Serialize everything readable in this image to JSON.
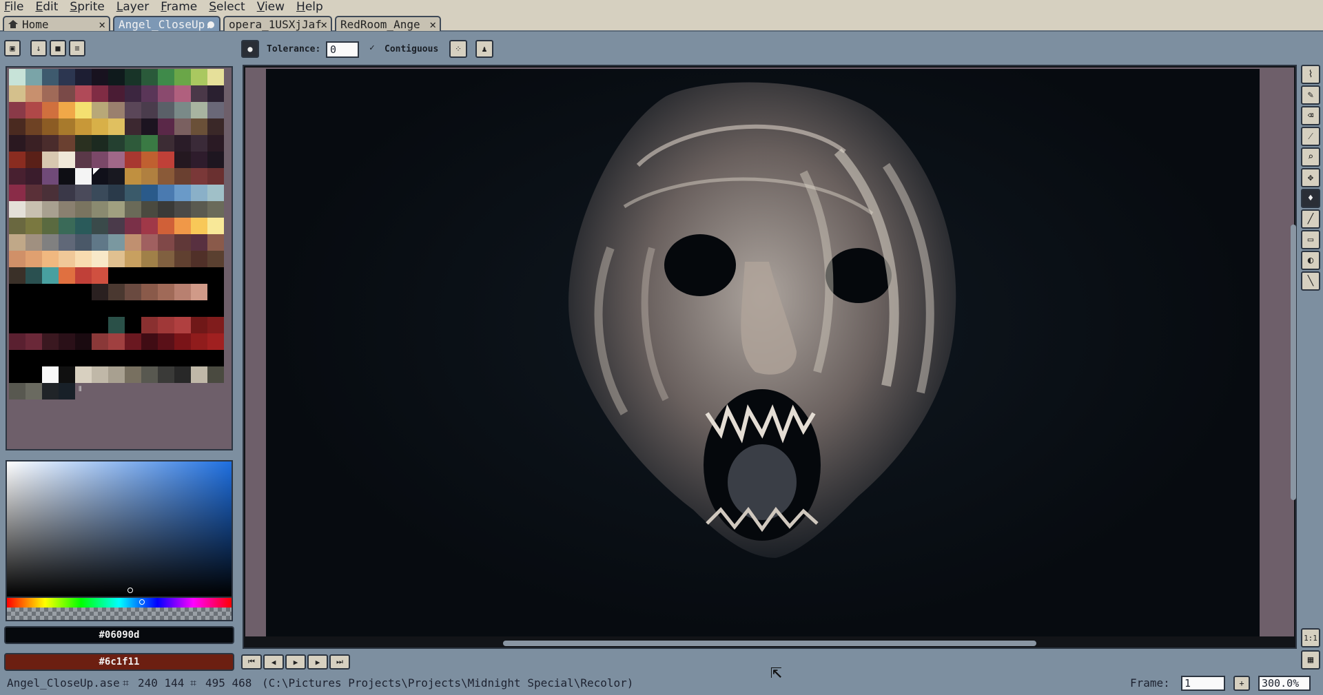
{
  "app": {
    "menu": [
      {
        "label": "File",
        "ul": "F",
        "rest": "ile"
      },
      {
        "label": "Edit",
        "ul": "E",
        "rest": "dit"
      },
      {
        "label": "Sprite",
        "ul": "S",
        "rest": "prite"
      },
      {
        "label": "Layer",
        "ul": "L",
        "rest": "ayer"
      },
      {
        "label": "Frame",
        "ul": "F",
        "rest": "rame"
      },
      {
        "label": "Select",
        "ul": "S",
        "rest": "elect"
      },
      {
        "label": "View",
        "ul": "V",
        "rest": "iew"
      },
      {
        "label": "Help",
        "ul": "H",
        "rest": "elp"
      }
    ]
  },
  "tabs": [
    {
      "label": "Home",
      "state": "normal"
    },
    {
      "label": "Angel_CloseUp.",
      "state": "active-modified"
    },
    {
      "label": "opera_1USXjJaf",
      "state": "normal"
    },
    {
      "label": "RedRoom_Ange",
      "state": "normal"
    }
  ],
  "context_bar": {
    "tolerance_label": "Tolerance:",
    "tolerance_value": "0",
    "contiguous_label": "Contiguous",
    "contiguous_checked": true
  },
  "palette": {
    "colors": [
      "#c7e3d8",
      "#7aa4a8",
      "#3e5a6e",
      "#2c3650",
      "#1d1e33",
      "#18121f",
      "#0f1a1c",
      "#183428",
      "#2a5a3a",
      "#3f8a4a",
      "#6aa648",
      "#aac860",
      "#e6e09a",
      "#d4c08c",
      "#c8906e",
      "#a06a58",
      "#7a4a48",
      "#b04a58",
      "#802c44",
      "#4a1c34",
      "#3c2640",
      "#5a3658",
      "#8a4a6e",
      "#b0607e",
      "#4a3848",
      "#2a2030",
      "#8a3a48",
      "#b04848",
      "#d0703e",
      "#f0a848",
      "#f4e070",
      "#b8a878",
      "#9a806e",
      "#5a4658",
      "#4a3c4c",
      "#5a6068",
      "#7a8a88",
      "#a8b4a0",
      "#6a6878",
      "#4a2a20",
      "#6e4224",
      "#8c5c24",
      "#a87a2c",
      "#c89838",
      "#d8b048",
      "#e0c060",
      "#3c2830",
      "#1c1420",
      "#5a2848",
      "#7a6060",
      "#6a5038",
      "#3a2828",
      "#2a1820",
      "#3a2024",
      "#4a2c2c",
      "#6a4030",
      "#2a3020",
      "#1c2a20",
      "#244030",
      "#2e5a3a",
      "#3a7a44",
      "#3c2c34",
      "#2a1c28",
      "#3a2a38",
      "#2a1a24",
      "#8a2c20",
      "#5a2018",
      "#d8c8b0",
      "#f0e8d8",
      "#5a3848",
      "#7a4868",
      "#a06888",
      "#a83830",
      "#c06030",
      "#c04038",
      "#241820",
      "#2e1c2c",
      "#1e1620",
      "#482030",
      "#3a1c2c",
      "#704a78",
      "#0e0e14",
      "#f4f4f4",
      "#10101a",
      "#181820",
      "#c09040",
      "#b08040",
      "#8a5a38",
      "#6a4030",
      "#7a3838",
      "#6a3030",
      "#8a2c48",
      "#5a3038",
      "#4a3038",
      "#3a3848",
      "#4a4a5a",
      "#3a4a5a",
      "#2a3a4a",
      "#3a5a6a",
      "#2a5a8a",
      "#4a7ab0",
      "#6a9ac8",
      "#8ab0c8",
      "#a0c0c8",
      "#e4e0d8",
      "#c8c0b0",
      "#a8a090",
      "#8a8070",
      "#7a7460",
      "#8a8a70",
      "#a0a080",
      "#6a6a58",
      "#4a4a40",
      "#3a3a38",
      "#4a4a48",
      "#5a5a50",
      "#6a6a5a",
      "#6a6840",
      "#7a7840",
      "#5a6a40",
      "#3a6a58",
      "#2a5a5a",
      "#3a4a4a",
      "#4a3a4a",
      "#7a3048",
      "#a03848",
      "#d06038",
      "#f09848",
      "#f8c858",
      "#f8e898",
      "#c0a888",
      "#a09080",
      "#808080",
      "#606878",
      "#4a5868",
      "#607888",
      "#7a98a0",
      "#c09070",
      "#a06060",
      "#804848",
      "#603838",
      "#583040",
      "#8a5a4a",
      "#d09068",
      "#e0a070",
      "#f0b880",
      "#f0c898",
      "#f8dcb0",
      "#f8e8c8",
      "#e0c090",
      "#c8a060",
      "#a08048",
      "#806040",
      "#604030",
      "#503028",
      "#5a4030",
      "#3a3028",
      "#2a5050",
      "#48a0a0",
      "#e07040",
      "#c04038",
      "#d05040",
      "#000000",
      "#000000",
      "#000000",
      "#000000",
      "#000000",
      "#000000",
      "#000000",
      "#000000",
      "#000000",
      "#000000",
      "#000000",
      "#000000",
      "#2a2020",
      "#4a3830",
      "#6a4a40",
      "#8a5a4a",
      "#a06a58",
      "#b88070",
      "#d09a88",
      "#000000",
      "#000000",
      "#000000",
      "#000000",
      "#000000",
      "#000000",
      "#000000",
      "#000000",
      "#000000",
      "#000000",
      "#000000",
      "#000000",
      "#000000",
      "#000000",
      "#000000",
      "#000000",
      "#000000",
      "#000000",
      "#000000",
      "#000000",
      "#2a5048",
      "#000000",
      "#8a3030",
      "#a03838",
      "#b04040",
      "#701818",
      "#801c1c",
      "#5a2030",
      "#6a2838",
      "#3a1820",
      "#2a1018",
      "#1a0a10",
      "#8a3838",
      "#a04040",
      "#6a1820",
      "#400c14",
      "#5a1018",
      "#7a1418",
      "#901c1c",
      "#a02020",
      "#000000",
      "#000000",
      "#000000",
      "#000000",
      "#000000",
      "#000000",
      "#000000",
      "#000000",
      "#000000",
      "#000000",
      "#000000",
      "#000000",
      "#000000",
      "#000000",
      "#000000",
      "#f8f8f8",
      "#101010",
      "#d8d0c0",
      "#c0b8a8",
      "#a8a090",
      "#787060",
      "#585850",
      "#3a3a38",
      "#282828",
      "#c0b8a8",
      "#4a4a40",
      "#585850",
      "#6a6a60",
      "#202428",
      "#182028"
    ]
  },
  "colors": {
    "foreground_hex": "#06090d",
    "foreground_color": "#06090d",
    "background_hex": "#6c1f11",
    "background_color": "#6c1f11"
  },
  "tools": [
    {
      "icon": "lasso-icon",
      "glyph": "⌇"
    },
    {
      "icon": "pencil-icon",
      "glyph": "✎"
    },
    {
      "icon": "eraser-icon",
      "glyph": "⌫"
    },
    {
      "icon": "eyedropper-icon",
      "glyph": "⁄"
    },
    {
      "icon": "zoom-icon",
      "glyph": "⌕"
    },
    {
      "icon": "move-icon",
      "glyph": "✥"
    },
    {
      "icon": "paint-bucket-icon",
      "glyph": "♦"
    },
    {
      "icon": "line-icon",
      "glyph": "╱"
    },
    {
      "icon": "rectangle-icon",
      "glyph": "▭"
    },
    {
      "icon": "contour-icon",
      "glyph": "◐"
    },
    {
      "icon": "blur-icon",
      "glyph": "╲"
    }
  ],
  "status": {
    "filename": "Angel_CloseUp.ase",
    "position": "240 144",
    "size": "495 468",
    "path": "(C:\\Pictures Projects\\Projects\\Midnight Special\\Recolor)",
    "frame_label": "Frame:",
    "frame_value": "1",
    "zoom_value": "300.0%"
  },
  "view": {
    "actual_size_label": "1:1"
  }
}
